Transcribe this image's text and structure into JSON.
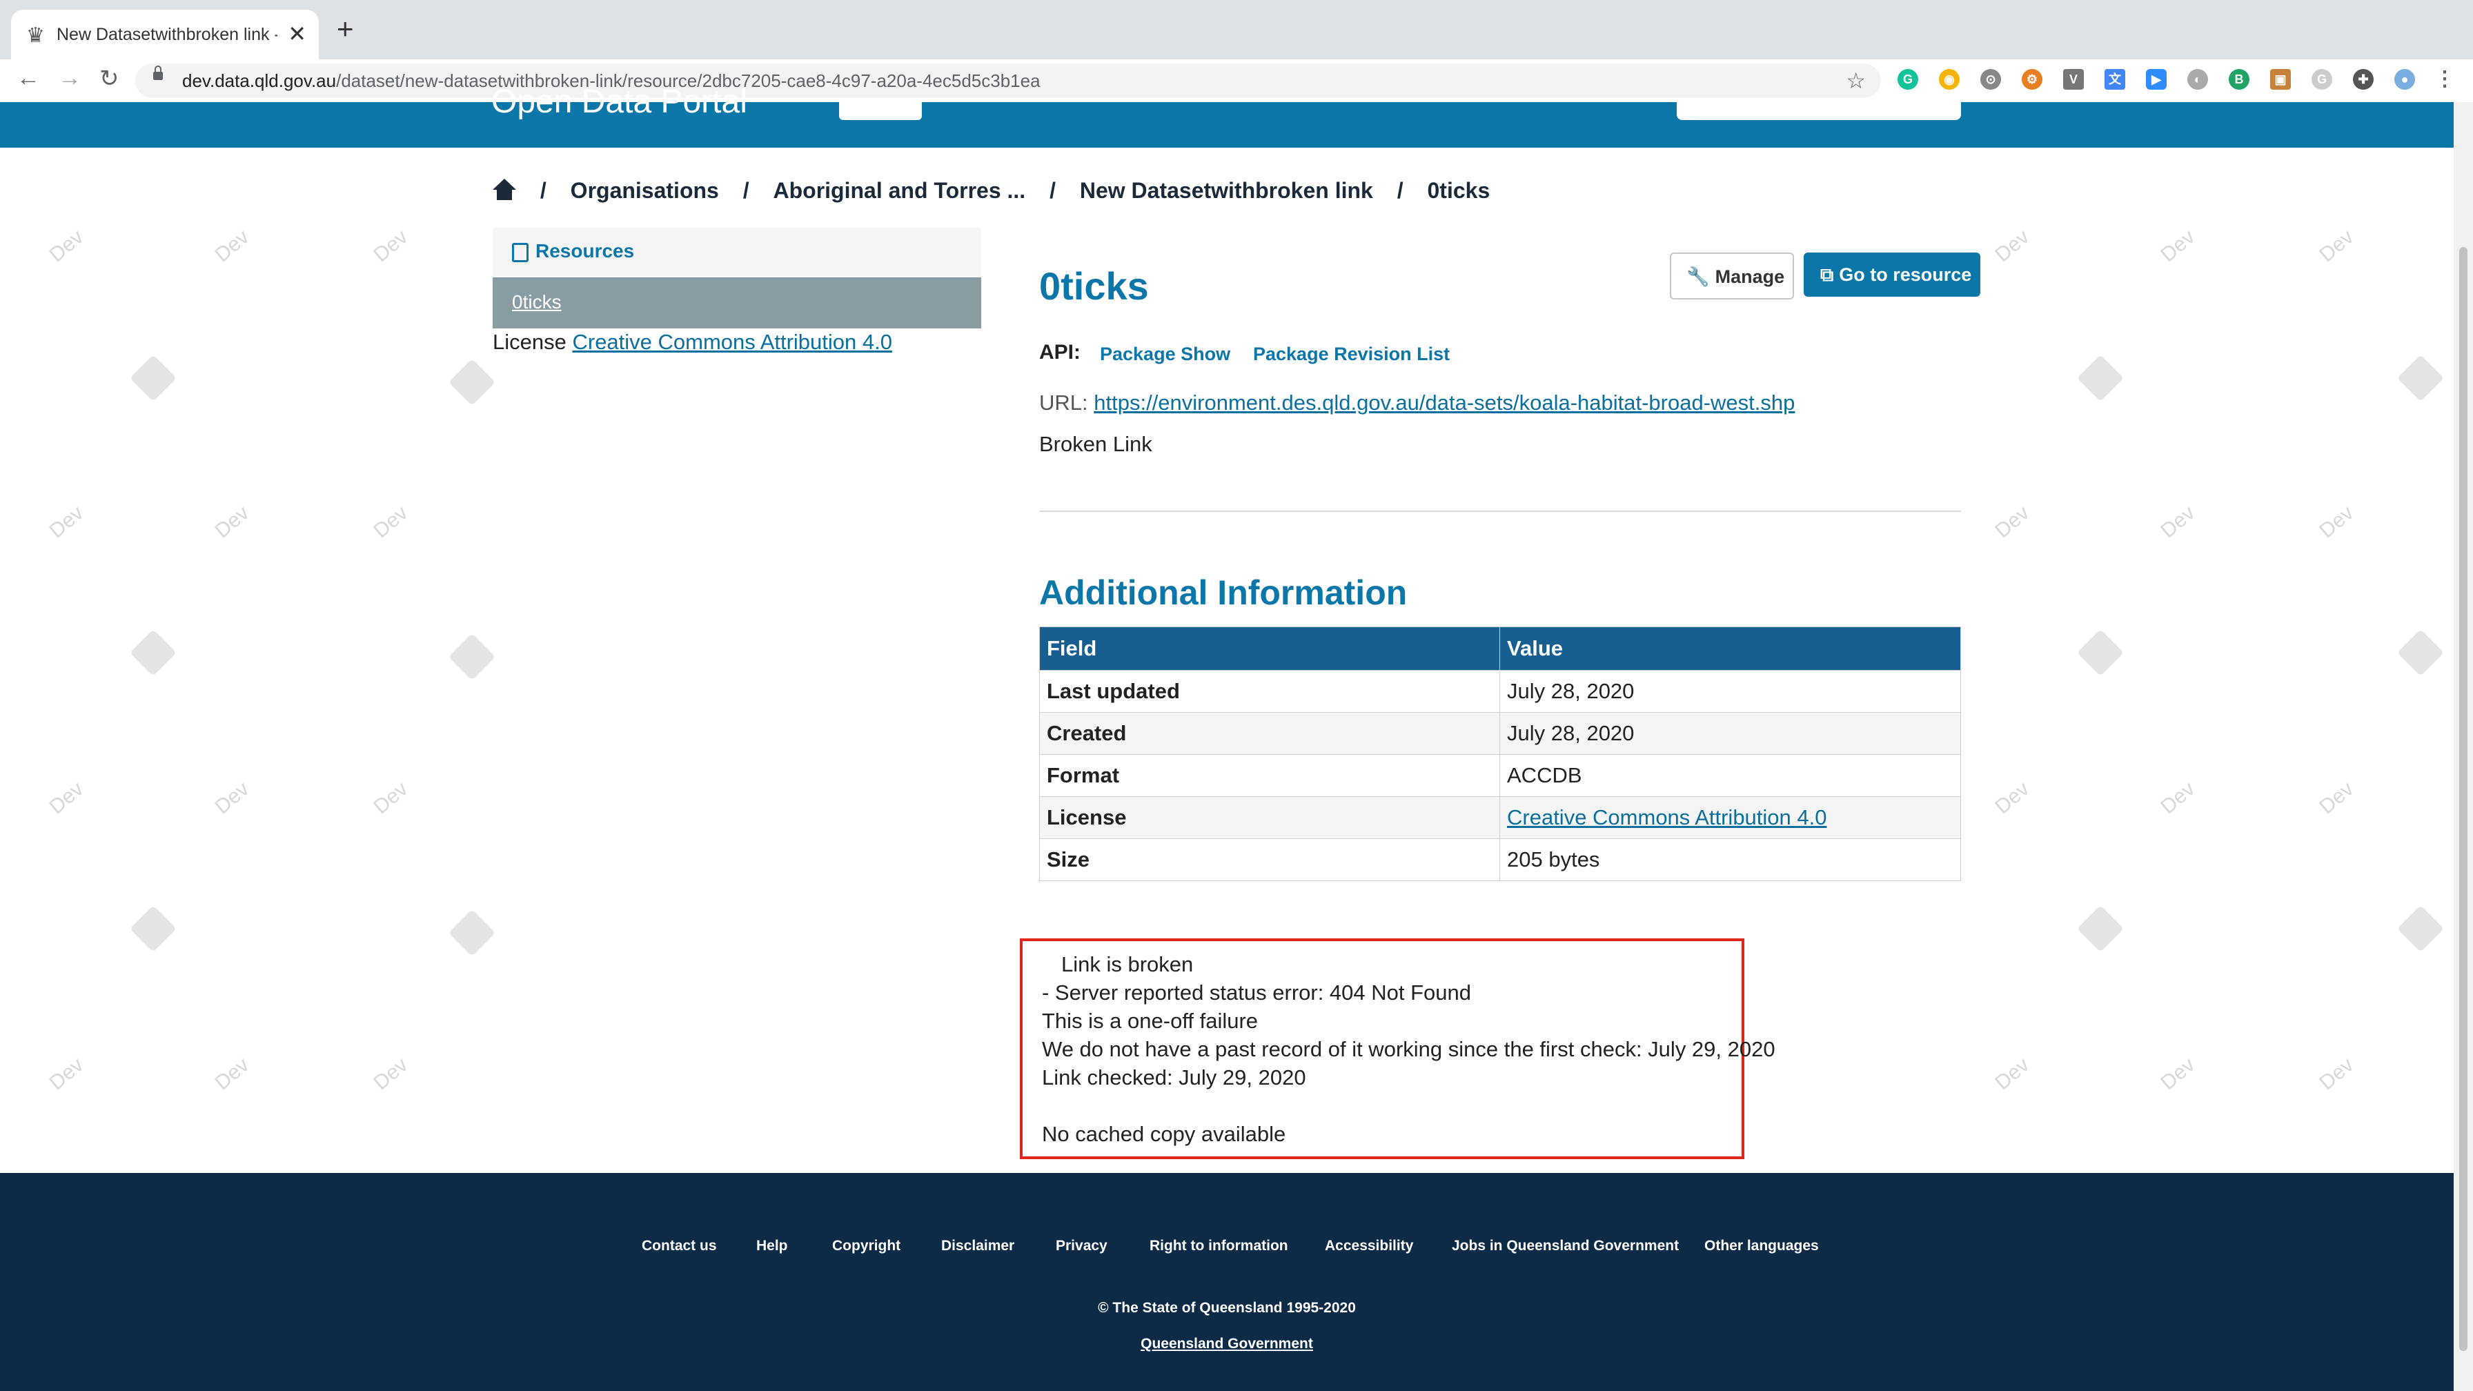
{
  "browser": {
    "tab_title": "New Datasetwithbroken link - C",
    "tab_close": "✕",
    "new_tab": "+",
    "url_host": "dev.data.qld.gov.au",
    "url_path": "/dataset/new-datasetwithbroken-link/resource/2dbc7205-cae8-4c97-a20a-4ec5d5c3b1ea"
  },
  "site": {
    "title": "Open Data Portal"
  },
  "watermark": "Dev",
  "breadcrumb": {
    "items": [
      "Organisations",
      "Aboriginal and Torres ...",
      "New Datasetwithbroken link",
      "0ticks"
    ],
    "separator": "/"
  },
  "sidebar": {
    "resources_label": "Resources",
    "active_item": "0ticks",
    "license_prefix": "License",
    "license_link": "Creative Commons Attribution 4.0"
  },
  "resource": {
    "title": "0ticks",
    "manage_label": "Manage",
    "go_label": "Go to resource",
    "api_label": "API:",
    "api_links": [
      "Package Show",
      "Package Revision List"
    ],
    "url_label": "URL:",
    "url": "https://environment.des.qld.gov.au/data-sets/koala-habitat-broad-west.shp",
    "status": "Broken Link"
  },
  "additional_info": {
    "heading": "Additional Information",
    "columns": [
      "Field",
      "Value"
    ],
    "rows": [
      {
        "field": "Last updated",
        "value": "July 28, 2020"
      },
      {
        "field": "Created",
        "value": "July 28, 2020"
      },
      {
        "field": "Format",
        "value": "ACCDB"
      },
      {
        "field": "License",
        "value": "Creative Commons Attribution 4.0"
      },
      {
        "field": "Size",
        "value": "205 bytes"
      }
    ]
  },
  "link_check": {
    "lines": [
      "Link is broken",
      "- Server reported status error: 404 Not Found",
      "This is a one-off failure",
      "We do not have a past record of it working since the first check: July 29, 2020",
      "Link checked: July 29, 2020",
      "No cached copy available"
    ]
  },
  "footer": {
    "links": [
      "Contact us",
      "Help",
      "Copyright",
      "Disclaimer",
      "Privacy",
      "Right to information",
      "Accessibility",
      "Jobs in Queensland Government",
      "Other languages"
    ],
    "copyright": "© The State of Queensland 1995-2020",
    "gov_link": "Queensland Government"
  }
}
